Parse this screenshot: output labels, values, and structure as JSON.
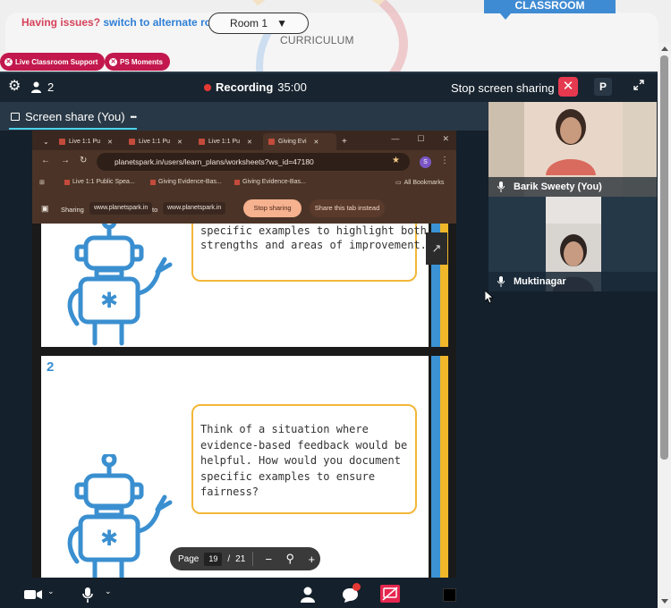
{
  "top": {
    "issue_prefix": "Having issues?",
    "issue_link": "switch to alternate room",
    "room_select": "Room 1",
    "curriculum": "CURRICULUM",
    "classroom_tab": "CLASSROOM",
    "pills": [
      "Live Classroom Support",
      "PS Moments"
    ]
  },
  "meeting": {
    "participant_count": "2",
    "recording_label": "Recording",
    "recording_time": "35:00",
    "stop_sharing_label": "Stop screen sharing",
    "profile_initial": "P",
    "screen_share_title": "Screen share (You)",
    "more_glyph": "•••"
  },
  "browser": {
    "tabs": [
      "Live 1:1 Pu",
      "Live 1:1 Pu",
      "Live 1:1 Pu",
      "Giving Evi"
    ],
    "add_tab": "+",
    "url": "planetspark.in/users/learn_plans/worksheets?ws_id=47180",
    "profile_letter": "S",
    "bookmarks": [
      "Live 1:1 Public Spea...",
      "Giving Evidence-Bas...",
      "Giving Evidence-Bas..."
    ],
    "all_bookmarks": "All Bookmarks",
    "sharing_label": "Sharing",
    "sharing_from": "www.planetspark.in",
    "sharing_to_word": "to",
    "sharing_to": "www.planetspark.in",
    "stop_sharing": "Stop sharing",
    "share_this_tab": "Share this tab instead"
  },
  "worksheet": {
    "card1_lines": [
      "specific examples to highlight both",
      "strengths and areas of improvement."
    ],
    "card2_number": "2",
    "card2_lines": [
      "Think of a situation where",
      "evidence-based feedback would be",
      "helpful. How would you document",
      "specific examples to ensure",
      "fairness?"
    ]
  },
  "pager": {
    "label": "Page",
    "current": "19",
    "separator": "/",
    "total": "21"
  },
  "participants": [
    {
      "name": "Barik Sweety (You)"
    },
    {
      "name": "Muktinagar"
    }
  ],
  "colors": {
    "accent_red": "#e53950",
    "pill_red": "#c2184d",
    "classroom_blue": "#3f8bd3",
    "meeting_bg": "#14202b",
    "robot_blue": "#3a8fd0",
    "bubble_border": "#f3b73a"
  }
}
